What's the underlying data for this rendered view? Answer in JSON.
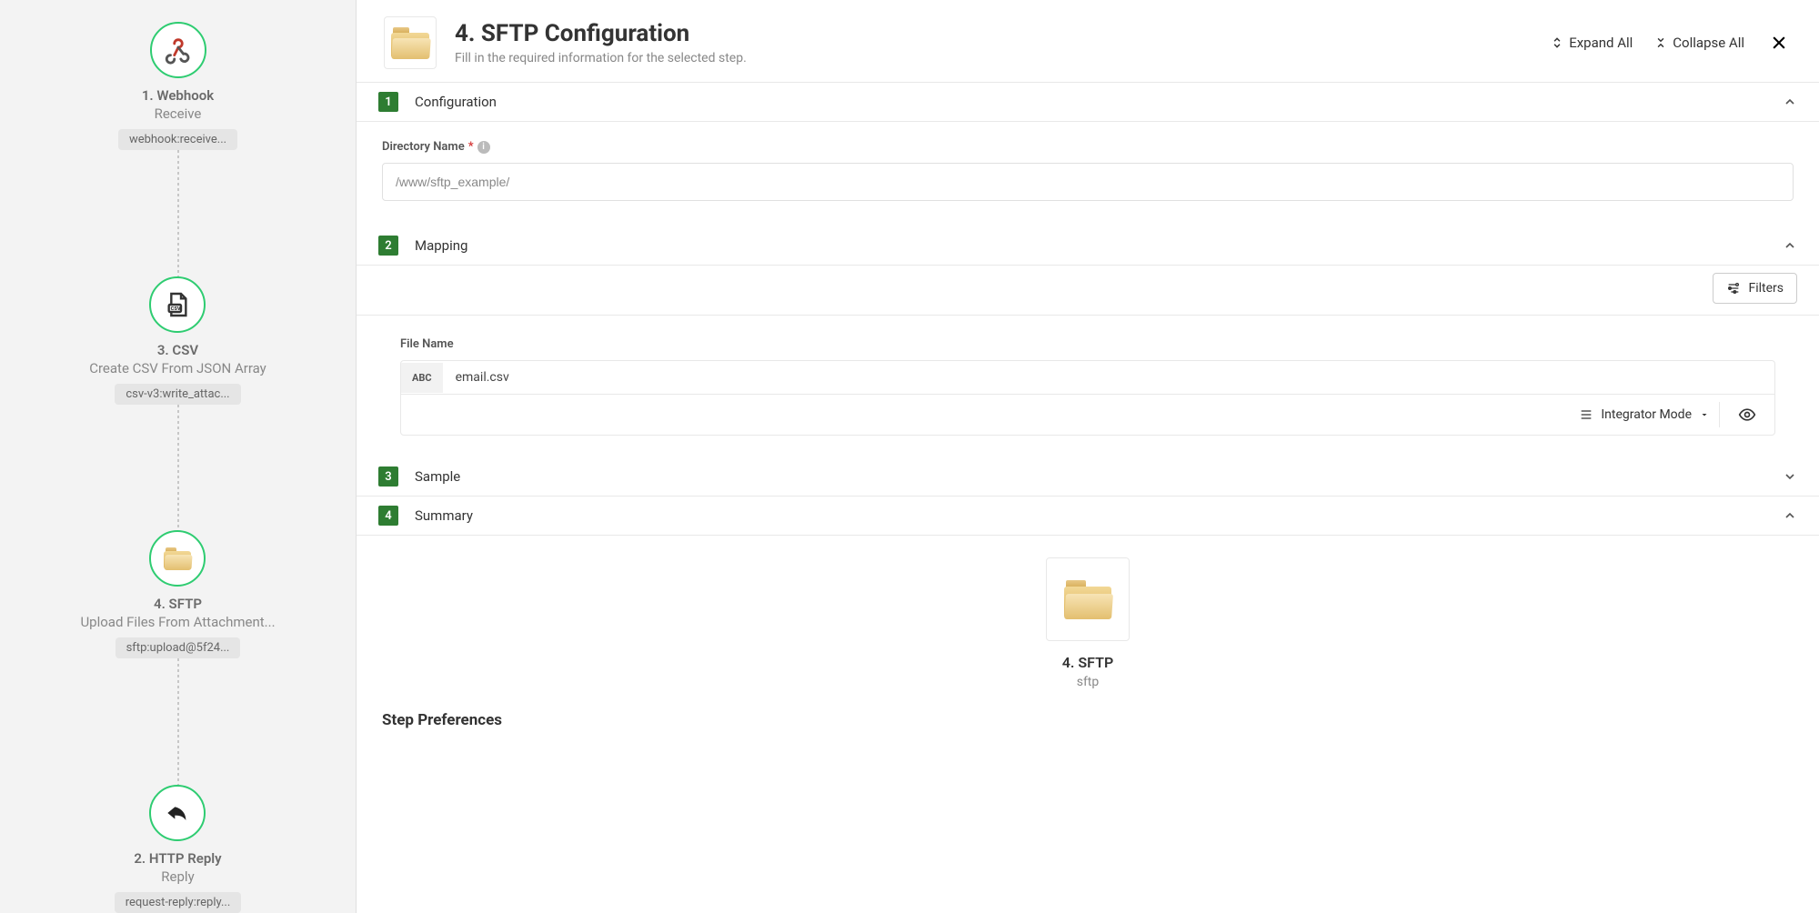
{
  "sidebar": {
    "nodes": [
      {
        "title": "1. Webhook",
        "subtitle": "Receive",
        "chip": "webhook:receive..."
      },
      {
        "title": "3. CSV",
        "subtitle": "Create CSV From JSON Array",
        "chip": "csv-v3:write_attac..."
      },
      {
        "title": "4. SFTP",
        "subtitle": "Upload Files From Attachment...",
        "chip": "sftp:upload@5f24..."
      },
      {
        "title": "2. HTTP Reply",
        "subtitle": "Reply",
        "chip": "request-reply:reply..."
      }
    ]
  },
  "header": {
    "title": "4. SFTP Configuration",
    "subtitle": "Fill in the required information for the selected step.",
    "expand_all": "Expand All",
    "collapse_all": "Collapse All"
  },
  "sections": {
    "configuration": {
      "number": "1",
      "title": "Configuration"
    },
    "mapping": {
      "number": "2",
      "title": "Mapping"
    },
    "sample": {
      "number": "3",
      "title": "Sample"
    },
    "summary": {
      "number": "4",
      "title": "Summary"
    }
  },
  "config": {
    "directory_label": "Directory Name",
    "directory_value": "/www/sftp_example/"
  },
  "mapping": {
    "filters_label": "Filters",
    "file_name_label": "File Name",
    "abc": "ABC",
    "file_name_value": "email.csv",
    "mode_label": "Integrator Mode"
  },
  "summary": {
    "title": "4. SFTP",
    "sub": "sftp"
  },
  "prefs_heading": "Step Preferences"
}
